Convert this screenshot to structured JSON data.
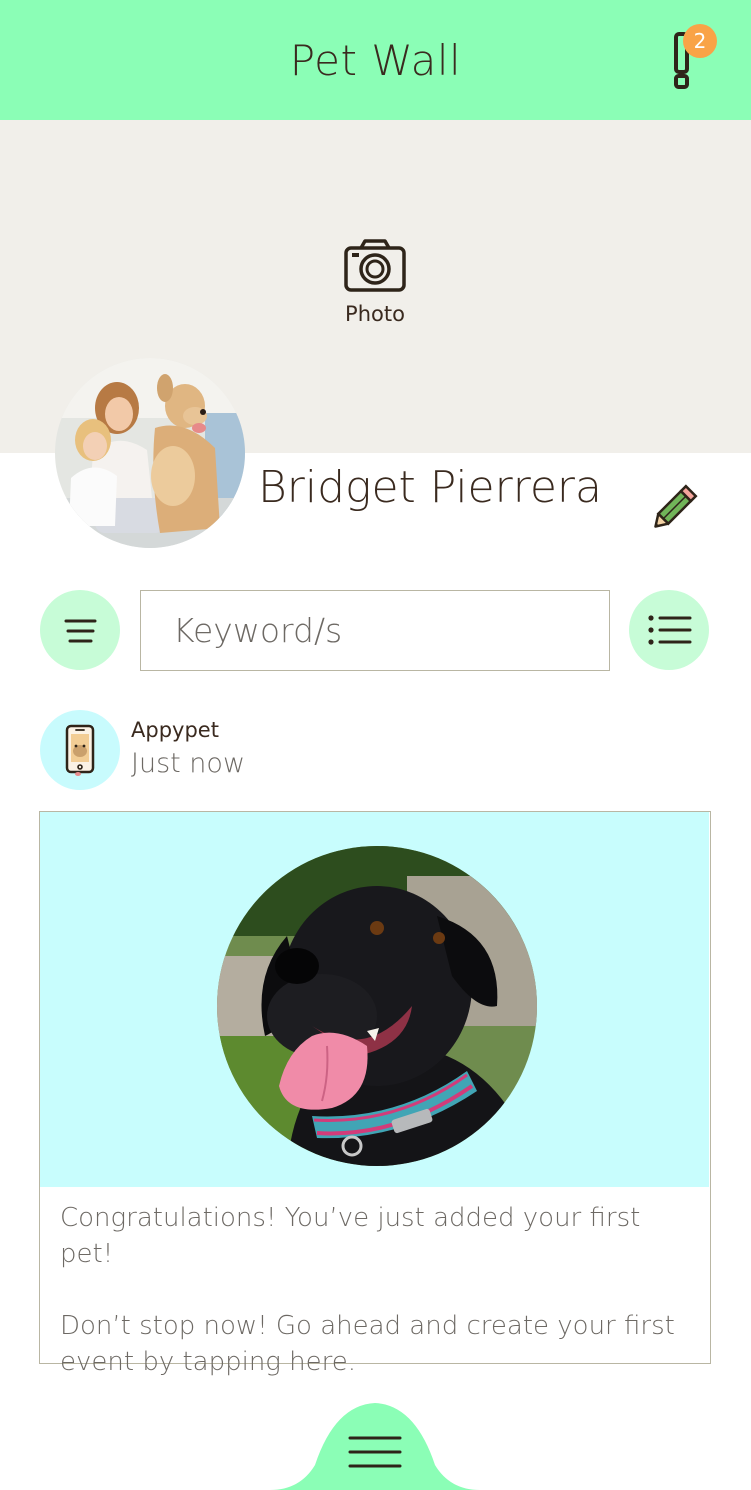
{
  "app": {
    "title": "Pet Wall"
  },
  "header": {
    "title": "Pet Wall",
    "notification_count": "2",
    "badge_color": "#f9a347",
    "bar_color": "#8bfeb6"
  },
  "cover": {
    "photo_label": "Photo",
    "icon": "camera-icon",
    "background": "#f1efea"
  },
  "profile": {
    "name": "Bridget Pierrera",
    "edit_icon": "pencil-icon"
  },
  "search": {
    "placeholder": "Keyword/s",
    "filter_icon": "filter-icon",
    "list_icon": "list-icon",
    "button_color": "#c7fcd7"
  },
  "post": {
    "author": "Appypet",
    "time": "Just now",
    "avatar_icon": "phone-pet-icon",
    "media_background": "#c8fdfd",
    "message_line1": "Congratulations! You’ve just added your first pet!",
    "message_line2": "Don’t stop now! Go ahead and create your first event by tapping here."
  },
  "bottom_nav": {
    "icon": "hamburger-menu-icon",
    "color": "#8bfeb6"
  }
}
